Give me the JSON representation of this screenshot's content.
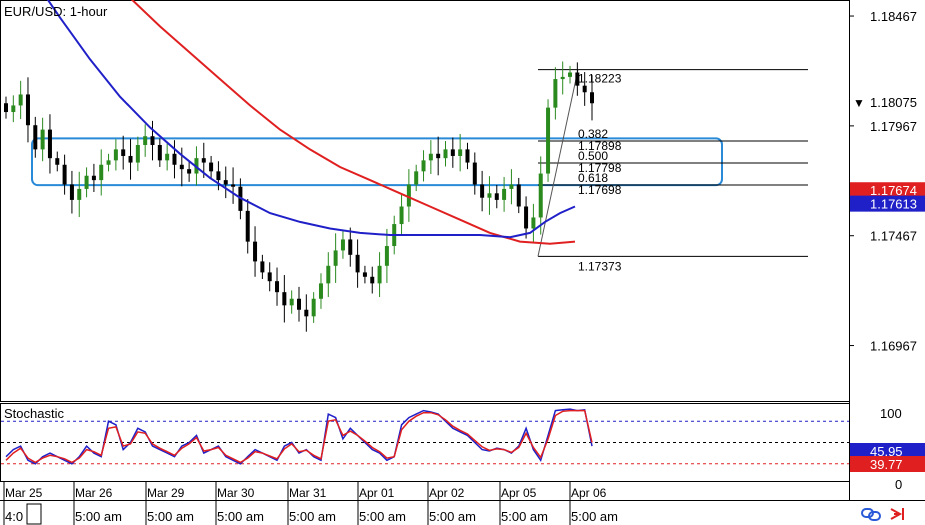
{
  "chart_data": [
    {
      "type": "candlestick",
      "title": "EUR/USD: 1-hour",
      "x_labels_top": [
        "Mar 25",
        "Mar 26",
        "Mar 29",
        "Mar 30",
        "Mar 31",
        "Apr 01",
        "Apr 02",
        "Apr 05",
        "Apr 06"
      ],
      "x_labels_bottom": [
        "4:0",
        "5:00 am",
        "5:00 am",
        "5:00 am",
        "5:00 am",
        "5:00 am",
        "5:00 am",
        "5:00 am",
        "5:00 am"
      ],
      "y_tick_labels": [
        "1.18467",
        "1.17967",
        "1.17467",
        "1.16967"
      ],
      "ylim": [
        1.1671,
        1.1854
      ],
      "price": [
        1.1803,
        1.1806,
        1.1811,
        1.1797,
        1.1786,
        1.1795,
        1.1782,
        1.1779,
        1.177,
        1.1763,
        1.1768,
        1.1774,
        1.1772,
        1.1779,
        1.1781,
        1.1786,
        1.1783,
        1.178,
        1.1788,
        1.1792,
        1.1788,
        1.1781,
        1.1784,
        1.1779,
        1.1777,
        1.1775,
        1.1782,
        1.178,
        1.1776,
        1.1772,
        1.177,
        1.1769,
        1.1758,
        1.1744,
        1.1735,
        1.173,
        1.1726,
        1.1721,
        1.1715,
        1.1718,
        1.1713,
        1.171,
        1.1718,
        1.1725,
        1.1733,
        1.174,
        1.1745,
        1.1738,
        1.173,
        1.1728,
        1.1725,
        1.1733,
        1.1742,
        1.1752,
        1.176,
        1.177,
        1.1776,
        1.1781,
        1.1784,
        1.1782,
        1.1786,
        1.1783,
        1.1786,
        1.178,
        1.177,
        1.1764,
        1.1766,
        1.1763,
        1.1768,
        1.177,
        1.176,
        1.175,
        1.1755,
        1.1775,
        1.1805,
        1.1818,
        1.1819,
        1.1821,
        1.1815,
        1.1812,
        1.1807
      ],
      "series": [
        {
          "name": "",
          "color": "#e02020",
          "values": [
            [
              72,
              1.188
            ],
            [
              100,
              1.1867
            ],
            [
              130,
              1.1855
            ],
            [
              160,
              1.1842
            ],
            [
              190,
              1.183
            ],
            [
              220,
              1.1818
            ],
            [
              250,
              1.1806
            ],
            [
              280,
              1.1795
            ],
            [
              310,
              1.1786
            ],
            [
              340,
              1.1778
            ],
            [
              370,
              1.1772
            ],
            [
              400,
              1.1766
            ],
            [
              430,
              1.176
            ],
            [
              460,
              1.1754
            ],
            [
              490,
              1.1748
            ],
            [
              520,
              1.1744
            ],
            [
              550,
              1.1743
            ],
            [
              575,
              1.1744
            ]
          ]
        },
        {
          "name": "",
          "color": "#2020c8",
          "values": [
            [
              0,
              1.189
            ],
            [
              30,
              1.1866
            ],
            [
              60,
              1.1846
            ],
            [
              90,
              1.1827
            ],
            [
              120,
              1.181
            ],
            [
              150,
              1.1796
            ],
            [
              180,
              1.1784
            ],
            [
              210,
              1.1773
            ],
            [
              240,
              1.1764
            ],
            [
              270,
              1.1757
            ],
            [
              300,
              1.1753
            ],
            [
              330,
              1.175
            ],
            [
              360,
              1.1748
            ],
            [
              390,
              1.1747
            ],
            [
              420,
              1.1747
            ],
            [
              450,
              1.1747
            ],
            [
              480,
              1.1747
            ],
            [
              510,
              1.1746
            ],
            [
              530,
              1.1748
            ],
            [
              545,
              1.1753
            ],
            [
              560,
              1.1757
            ],
            [
              575,
              1.176
            ]
          ]
        }
      ],
      "fibonacci": [
        {
          "ratio": "",
          "price": "1.18223",
          "value": 1.18223
        },
        {
          "ratio": "0.382",
          "price": "1.17898",
          "value": 1.17898
        },
        {
          "ratio": "0.500",
          "price": "1.17798",
          "value": 1.17798
        },
        {
          "ratio": "0.618",
          "price": "1.17698",
          "value": 1.17698
        },
        {
          "ratio": "",
          "price": "1.17373",
          "value": 1.17373
        }
      ],
      "zone": {
        "from": 1.17697,
        "to": 1.1791,
        "color": "#2a8ad8"
      },
      "price_tags": [
        {
          "label": "1.18075",
          "value": 1.18075,
          "bg": "#ffffff",
          "fg": "#000000",
          "marker": "▼"
        },
        {
          "label": "1.17674",
          "value": 1.17674,
          "bg": "#e02020",
          "fg": "#ffffff",
          "marker": ""
        },
        {
          "label": "1.17613",
          "value": 1.17613,
          "bg": "#2020c8",
          "fg": "#ffffff",
          "marker": ""
        }
      ],
      "candle_up": "#2a8a1e",
      "candle_down": "#000000"
    },
    {
      "type": "line",
      "title": "Stochastic",
      "ylim": [
        0,
        100
      ],
      "y_tick_labels": [
        "100",
        "0"
      ],
      "levels": [
        80,
        50,
        20
      ],
      "price_tags": [
        {
          "label": "45.95",
          "value": 45.95,
          "bg": "#2020c8",
          "fg": "#ffffff"
        },
        {
          "label": "39.77",
          "value": 39.77,
          "bg": "#e02020",
          "fg": "#ffffff"
        }
      ],
      "series": [
        {
          "name": "",
          "color": "#2020c8",
          "values": [
            30,
            40,
            45,
            25,
            20,
            30,
            35,
            30,
            25,
            20,
            30,
            45,
            35,
            30,
            80,
            75,
            40,
            50,
            70,
            65,
            45,
            40,
            35,
            30,
            45,
            50,
            60,
            35,
            40,
            45,
            30,
            25,
            20,
            30,
            40,
            35,
            30,
            25,
            45,
            50,
            35,
            40,
            30,
            25,
            90,
            85,
            55,
            70,
            60,
            50,
            40,
            35,
            25,
            30,
            75,
            85,
            90,
            95,
            93,
            90,
            80,
            70,
            65,
            60,
            50,
            40,
            38,
            42,
            40,
            35,
            45,
            70,
            40,
            25,
            60,
            95,
            96,
            97,
            95,
            96,
            45
          ]
        },
        {
          "name": "",
          "color": "#e02020",
          "values": [
            25,
            35,
            42,
            28,
            22,
            28,
            32,
            30,
            27,
            22,
            28,
            40,
            37,
            32,
            70,
            72,
            45,
            48,
            65,
            63,
            48,
            42,
            37,
            32,
            42,
            48,
            57,
            38,
            40,
            43,
            32,
            27,
            22,
            28,
            37,
            35,
            31,
            27,
            41,
            48,
            37,
            39,
            32,
            27,
            80,
            82,
            60,
            66,
            60,
            52,
            43,
            37,
            28,
            30,
            68,
            80,
            87,
            92,
            92,
            89,
            82,
            73,
            67,
            62,
            53,
            44,
            39,
            41,
            40,
            36,
            43,
            63,
            43,
            29,
            55,
            88,
            94,
            95,
            95,
            95,
            50
          ]
        }
      ]
    }
  ],
  "toolbar": {
    "link_icon": "link-icon",
    "arrow_icon": "jump-to-end-icon"
  }
}
